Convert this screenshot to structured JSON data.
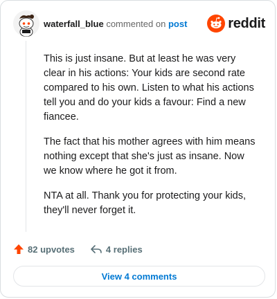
{
  "header": {
    "username": "waterfall_blue",
    "action_text": "commented on",
    "post_link": "post",
    "brand_name": "reddit",
    "brand_color": "#ff4500"
  },
  "comment": {
    "paragraphs": [
      "This is just insane. But at least he was very clear in his actions: Your kids are second rate compared to his own. Listen to what his actions tell you and do your kids a favour: Find a new fiancee.",
      "The fact that his mother agrees with him means nothing except that she's just as insane. Now we know where he got it from.",
      "NTA at all. Thank you for protecting your kids, they'll never forget it."
    ]
  },
  "actions": {
    "upvotes_label": "82 upvotes",
    "replies_label": "4 replies",
    "upvote_icon": "arrow-up-icon",
    "reply_icon": "reply-arrow-icon"
  },
  "footer": {
    "view_comments_label": "View 4 comments"
  }
}
